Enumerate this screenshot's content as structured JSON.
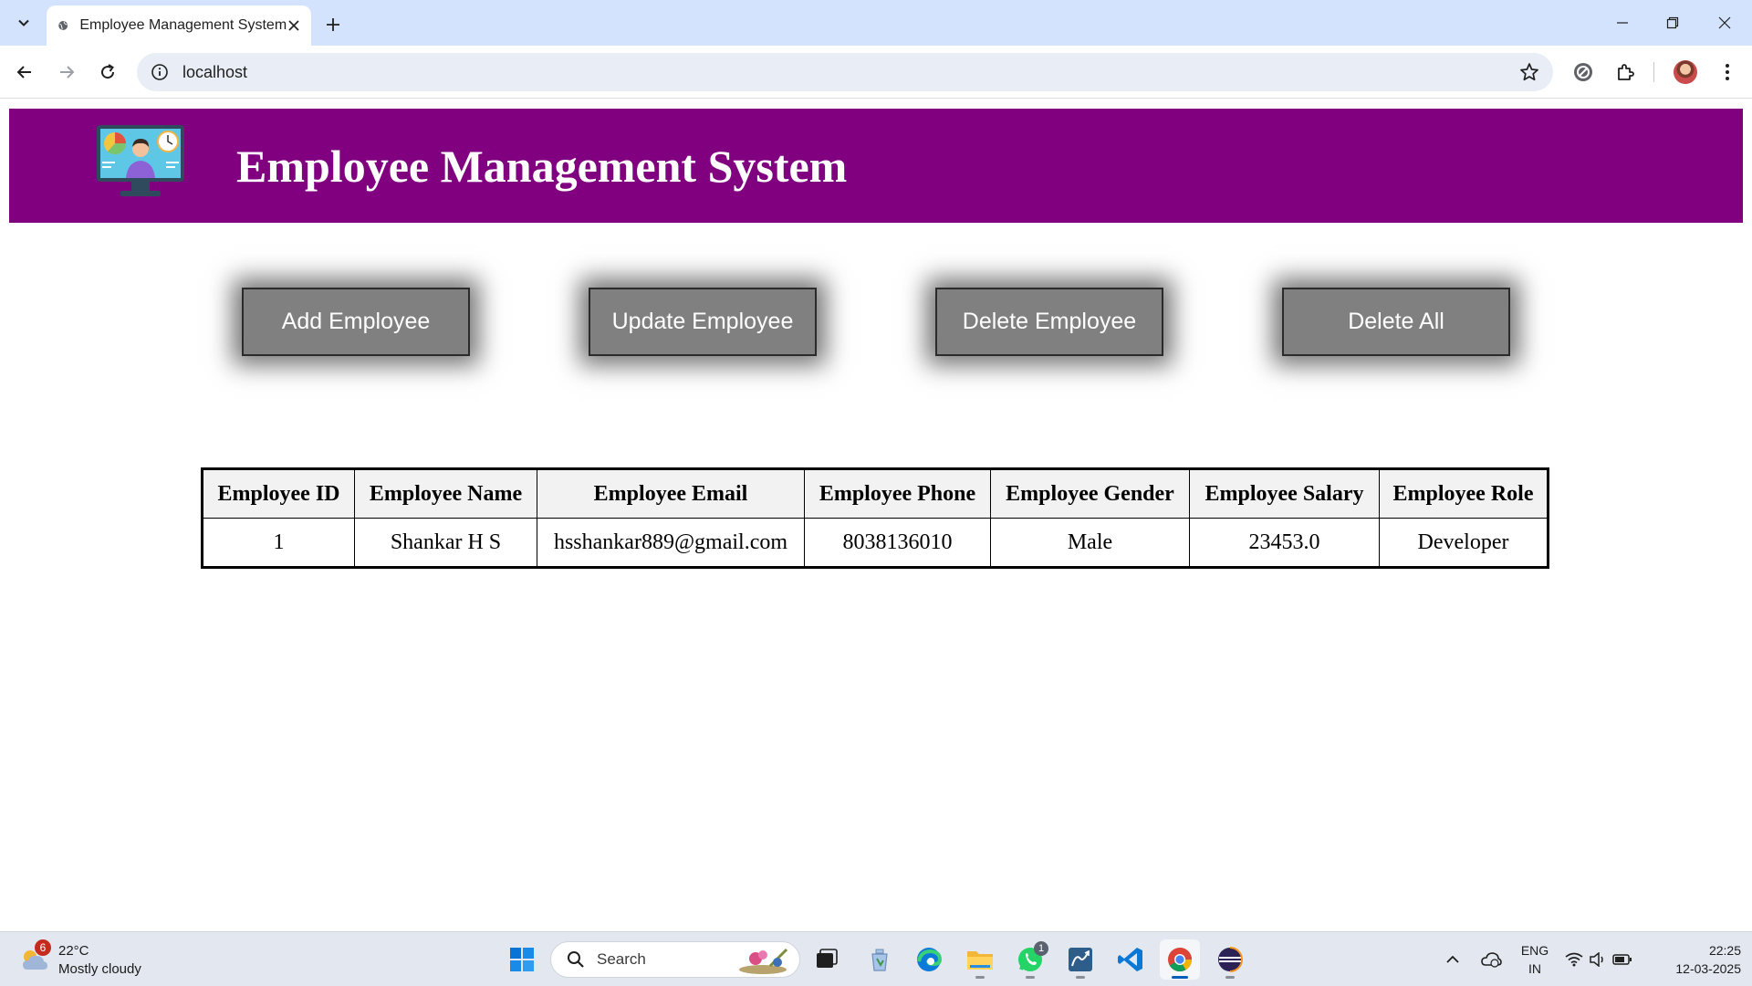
{
  "browser": {
    "tab_title": "Employee Management System",
    "url": "localhost"
  },
  "header": {
    "title": "Employee Management System"
  },
  "actions": {
    "add": "Add Employee",
    "update": "Update Employee",
    "delete": "Delete Employee",
    "delete_all": "Delete All"
  },
  "table": {
    "columns": [
      "Employee ID",
      "Employee Name",
      "Employee Email",
      "Employee Phone",
      "Employee Gender",
      "Employee Salary",
      "Employee Role"
    ],
    "rows": [
      [
        "1",
        "Shankar H S",
        "hsshankar889@gmail.com",
        "8038136010",
        "Male",
        "23453.0",
        "Developer"
      ]
    ]
  },
  "taskbar": {
    "weather_badge": "6",
    "weather_temp": "22°C",
    "weather_desc": "Mostly cloudy",
    "search_placeholder": "Search",
    "whatsapp_badge": "1",
    "lang_top": "ENG",
    "lang_bottom": "IN",
    "time": "22:25",
    "date": "12-03-2025"
  },
  "colors": {
    "header_bg": "#800080",
    "button_bg": "#808080",
    "tabbar_bg": "#d3e3fd"
  }
}
